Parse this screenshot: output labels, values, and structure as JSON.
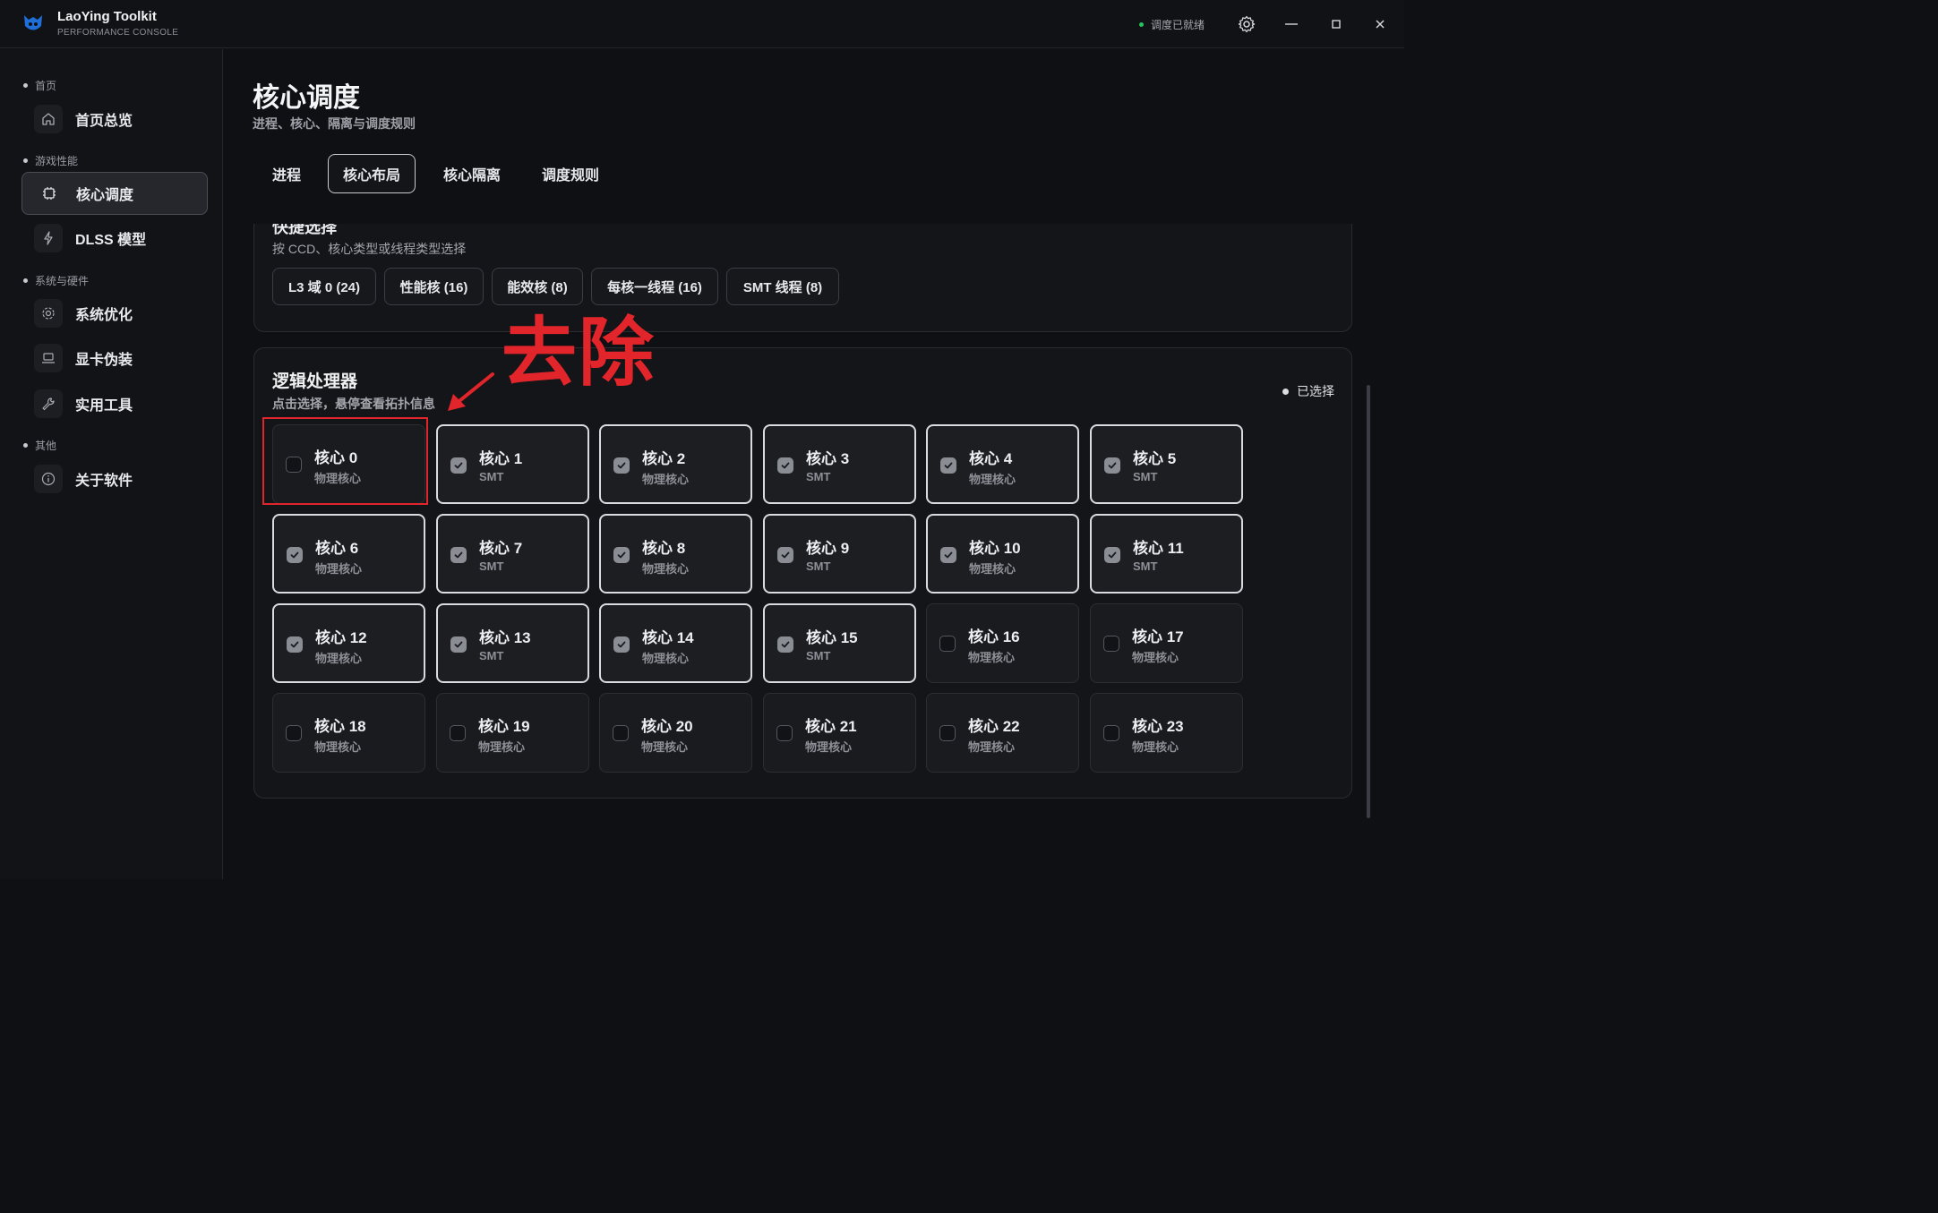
{
  "app": {
    "name": "LaoYing Toolkit",
    "subtitle": "PERFORMANCE CONSOLE",
    "status": "调度已就绪"
  },
  "colors": {
    "status_ok": "#22c55e",
    "annotation": "#e1252a",
    "selected_border": "#d9dbe0"
  },
  "sidebar": {
    "groups": [
      {
        "label": "首页",
        "items": [
          {
            "label": "首页总览",
            "icon": "home-icon"
          }
        ]
      },
      {
        "label": "游戏性能",
        "items": [
          {
            "label": "核心调度",
            "icon": "cpu-chip-icon",
            "active": true
          },
          {
            "label": "DLSS 模型",
            "icon": "lightning-icon"
          }
        ]
      },
      {
        "label": "系统与硬件",
        "items": [
          {
            "label": "系统优化",
            "icon": "gear-icon"
          },
          {
            "label": "显卡伪装",
            "icon": "laptop-icon"
          },
          {
            "label": "实用工具",
            "icon": "wrench-icon"
          }
        ]
      },
      {
        "label": "其他",
        "items": [
          {
            "label": "关于软件",
            "icon": "info-icon"
          }
        ]
      }
    ]
  },
  "page": {
    "title": "核心调度",
    "subtitle": "进程、核心、隔离与调度规则"
  },
  "tabs": [
    {
      "label": "进程"
    },
    {
      "label": "核心布局",
      "active": true
    },
    {
      "label": "核心隔离"
    },
    {
      "label": "调度规则"
    }
  ],
  "quick_select": {
    "title": "快捷选择",
    "subtitle": "按 CCD、核心类型或线程类型选择",
    "chips": [
      "L3 域 0 (24)",
      "性能核 (16)",
      "能效核 (8)",
      "每核一线程 (16)",
      "SMT 线程 (8)"
    ]
  },
  "processors": {
    "title": "逻辑处理器",
    "subtitle": "点击选择，悬停查看拓扑信息",
    "legend": "已选择",
    "cores": [
      {
        "name": "核心 0",
        "type": "物理核心",
        "selected": false
      },
      {
        "name": "核心 1",
        "type": "SMT",
        "selected": true
      },
      {
        "name": "核心 2",
        "type": "物理核心",
        "selected": true
      },
      {
        "name": "核心 3",
        "type": "SMT",
        "selected": true
      },
      {
        "name": "核心 4",
        "type": "物理核心",
        "selected": true
      },
      {
        "name": "核心 5",
        "type": "SMT",
        "selected": true
      },
      {
        "name": "核心 6",
        "type": "物理核心",
        "selected": true
      },
      {
        "name": "核心 7",
        "type": "SMT",
        "selected": true
      },
      {
        "name": "核心 8",
        "type": "物理核心",
        "selected": true
      },
      {
        "name": "核心 9",
        "type": "SMT",
        "selected": true
      },
      {
        "name": "核心 10",
        "type": "物理核心",
        "selected": true
      },
      {
        "name": "核心 11",
        "type": "SMT",
        "selected": true
      },
      {
        "name": "核心 12",
        "type": "物理核心",
        "selected": true
      },
      {
        "name": "核心 13",
        "type": "SMT",
        "selected": true
      },
      {
        "name": "核心 14",
        "type": "物理核心",
        "selected": true
      },
      {
        "name": "核心 15",
        "type": "SMT",
        "selected": true
      },
      {
        "name": "核心 16",
        "type": "物理核心",
        "selected": false
      },
      {
        "name": "核心 17",
        "type": "物理核心",
        "selected": false
      },
      {
        "name": "核心 18",
        "type": "物理核心",
        "selected": false
      },
      {
        "name": "核心 19",
        "type": "物理核心",
        "selected": false
      },
      {
        "name": "核心 20",
        "type": "物理核心",
        "selected": false
      },
      {
        "name": "核心 21",
        "type": "物理核心",
        "selected": false
      },
      {
        "name": "核心 22",
        "type": "物理核心",
        "selected": false
      },
      {
        "name": "核心 23",
        "type": "物理核心",
        "selected": false
      }
    ]
  },
  "annotation": {
    "text": "去除"
  }
}
